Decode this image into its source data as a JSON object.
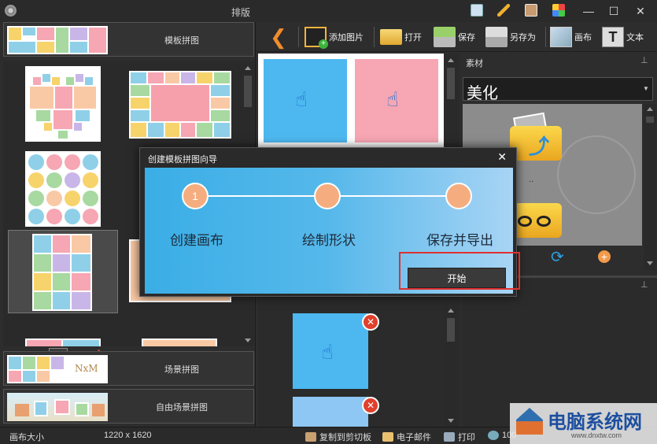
{
  "window": {
    "title": "排版",
    "minimize": "—",
    "maximize": "☐",
    "close": "✕"
  },
  "left_panel": {
    "template_collage": "模板拼图",
    "scene_collage": "场景拼图",
    "scene_thumb_text": "NxM",
    "free_scene_collage": "自由场景拼图"
  },
  "toolbar": {
    "add_image": "添加图片",
    "open": "打开",
    "save": "保存",
    "save_as": "另存为",
    "canvas": "画布",
    "text": "文本"
  },
  "right_panel": {
    "material_label": "素材",
    "category_selected": "美化",
    "folder_caption": ".."
  },
  "dialog": {
    "title": "创建模板拼图向导",
    "close": "✕",
    "steps": [
      {
        "number": "1",
        "label": "创建画布"
      },
      {
        "number": "",
        "label": "绘制形状"
      },
      {
        "number": "",
        "label": "保存并导出"
      }
    ],
    "start_button": "开始"
  },
  "status": {
    "canvas_size_label": "画布大小",
    "canvas_size_value": "1220 x 1620",
    "copy_clipboard": "复制到剪切板",
    "email": "电子邮件",
    "print": "打印",
    "zoom": "100"
  },
  "watermark": {
    "text": "电脑系统网",
    "url": "www.dnxtw.com"
  },
  "colors": {
    "accent_blue": "#4db8f0",
    "pink": "#f7a6b3",
    "orange": "#f5ad80",
    "highlight_red": "#e03030"
  }
}
